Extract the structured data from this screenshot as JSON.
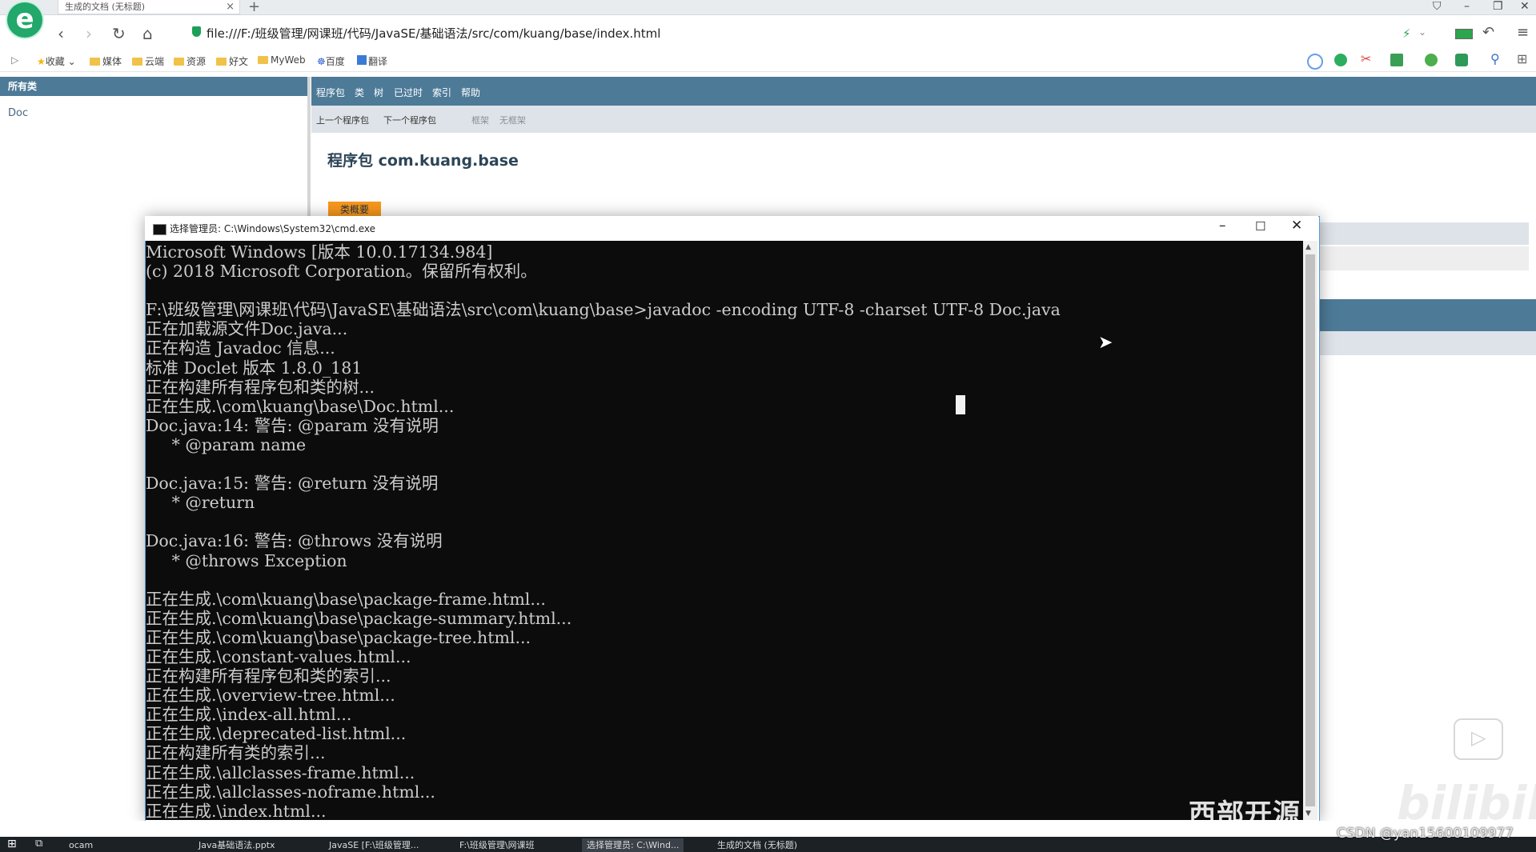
{
  "browser": {
    "tab_title": "生成的文档 (无标题)",
    "url": "file:///F:/班级管理/网课班/代码/JavaSE/基础语法/src/com/kuang/base/index.html",
    "bookmarks": [
      "收藏",
      "媒体",
      "云端",
      "资源",
      "好文",
      "MyWeb",
      "百度",
      "翻译"
    ]
  },
  "javadoc": {
    "left_header": "所有类",
    "left_items": [
      "Doc"
    ],
    "nav": [
      "程序包",
      "类",
      "树",
      "已过时",
      "索引",
      "帮助"
    ],
    "subnav": [
      "上一个程序包",
      "下一个程序包",
      "框架",
      "无框架"
    ],
    "package_title": "程序包 com.kuang.base",
    "summary_tab": "类概要"
  },
  "cmd": {
    "title": "选择管理员: C:\\Windows\\System32\\cmd.exe",
    "lines": [
      "Microsoft Windows [版本 10.0.17134.984]",
      "(c) 2018 Microsoft Corporation。保留所有权利。",
      "",
      "F:\\班级管理\\网课班\\代码\\JavaSE\\基础语法\\src\\com\\kuang\\base>javadoc -encoding UTF-8 -charset UTF-8 Doc.java",
      "正在加载源文件Doc.java...",
      "正在构造 Javadoc 信息...",
      "标准 Doclet 版本 1.8.0_181",
      "正在构建所有程序包和类的树...",
      "正在生成.\\com\\kuang\\base\\Doc.html...",
      "Doc.java:14: 警告: @param 没有说明",
      "     * @param name",
      "",
      "Doc.java:15: 警告: @return 没有说明",
      "     * @return",
      "",
      "Doc.java:16: 警告: @throws 没有说明",
      "     * @throws Exception",
      "",
      "正在生成.\\com\\kuang\\base\\package-frame.html...",
      "正在生成.\\com\\kuang\\base\\package-summary.html...",
      "正在生成.\\com\\kuang\\base\\package-tree.html...",
      "正在生成.\\constant-values.html...",
      "正在构建所有程序包和类的索引...",
      "正在生成.\\overview-tree.html...",
      "正在生成.\\index-all.html...",
      "正在生成.\\deprecated-list.html...",
      "正在构建所有类的索引...",
      "正在生成.\\allclasses-frame.html...",
      "正在生成.\\allclasses-noframe.html...",
      "正在生成.\\index.html..."
    ]
  },
  "taskbar": {
    "items": [
      "ocam",
      "Java基础语法.pptx",
      "JavaSE [F:\\班级管理...",
      "F:\\班级管理\\网课班",
      "选择管理员: C:\\Wind...",
      "生成的文档 (无标题)"
    ]
  },
  "watermark": {
    "text": "西部开源",
    "site": "bilibili",
    "csdn": "CSDN @yan15600109977"
  }
}
